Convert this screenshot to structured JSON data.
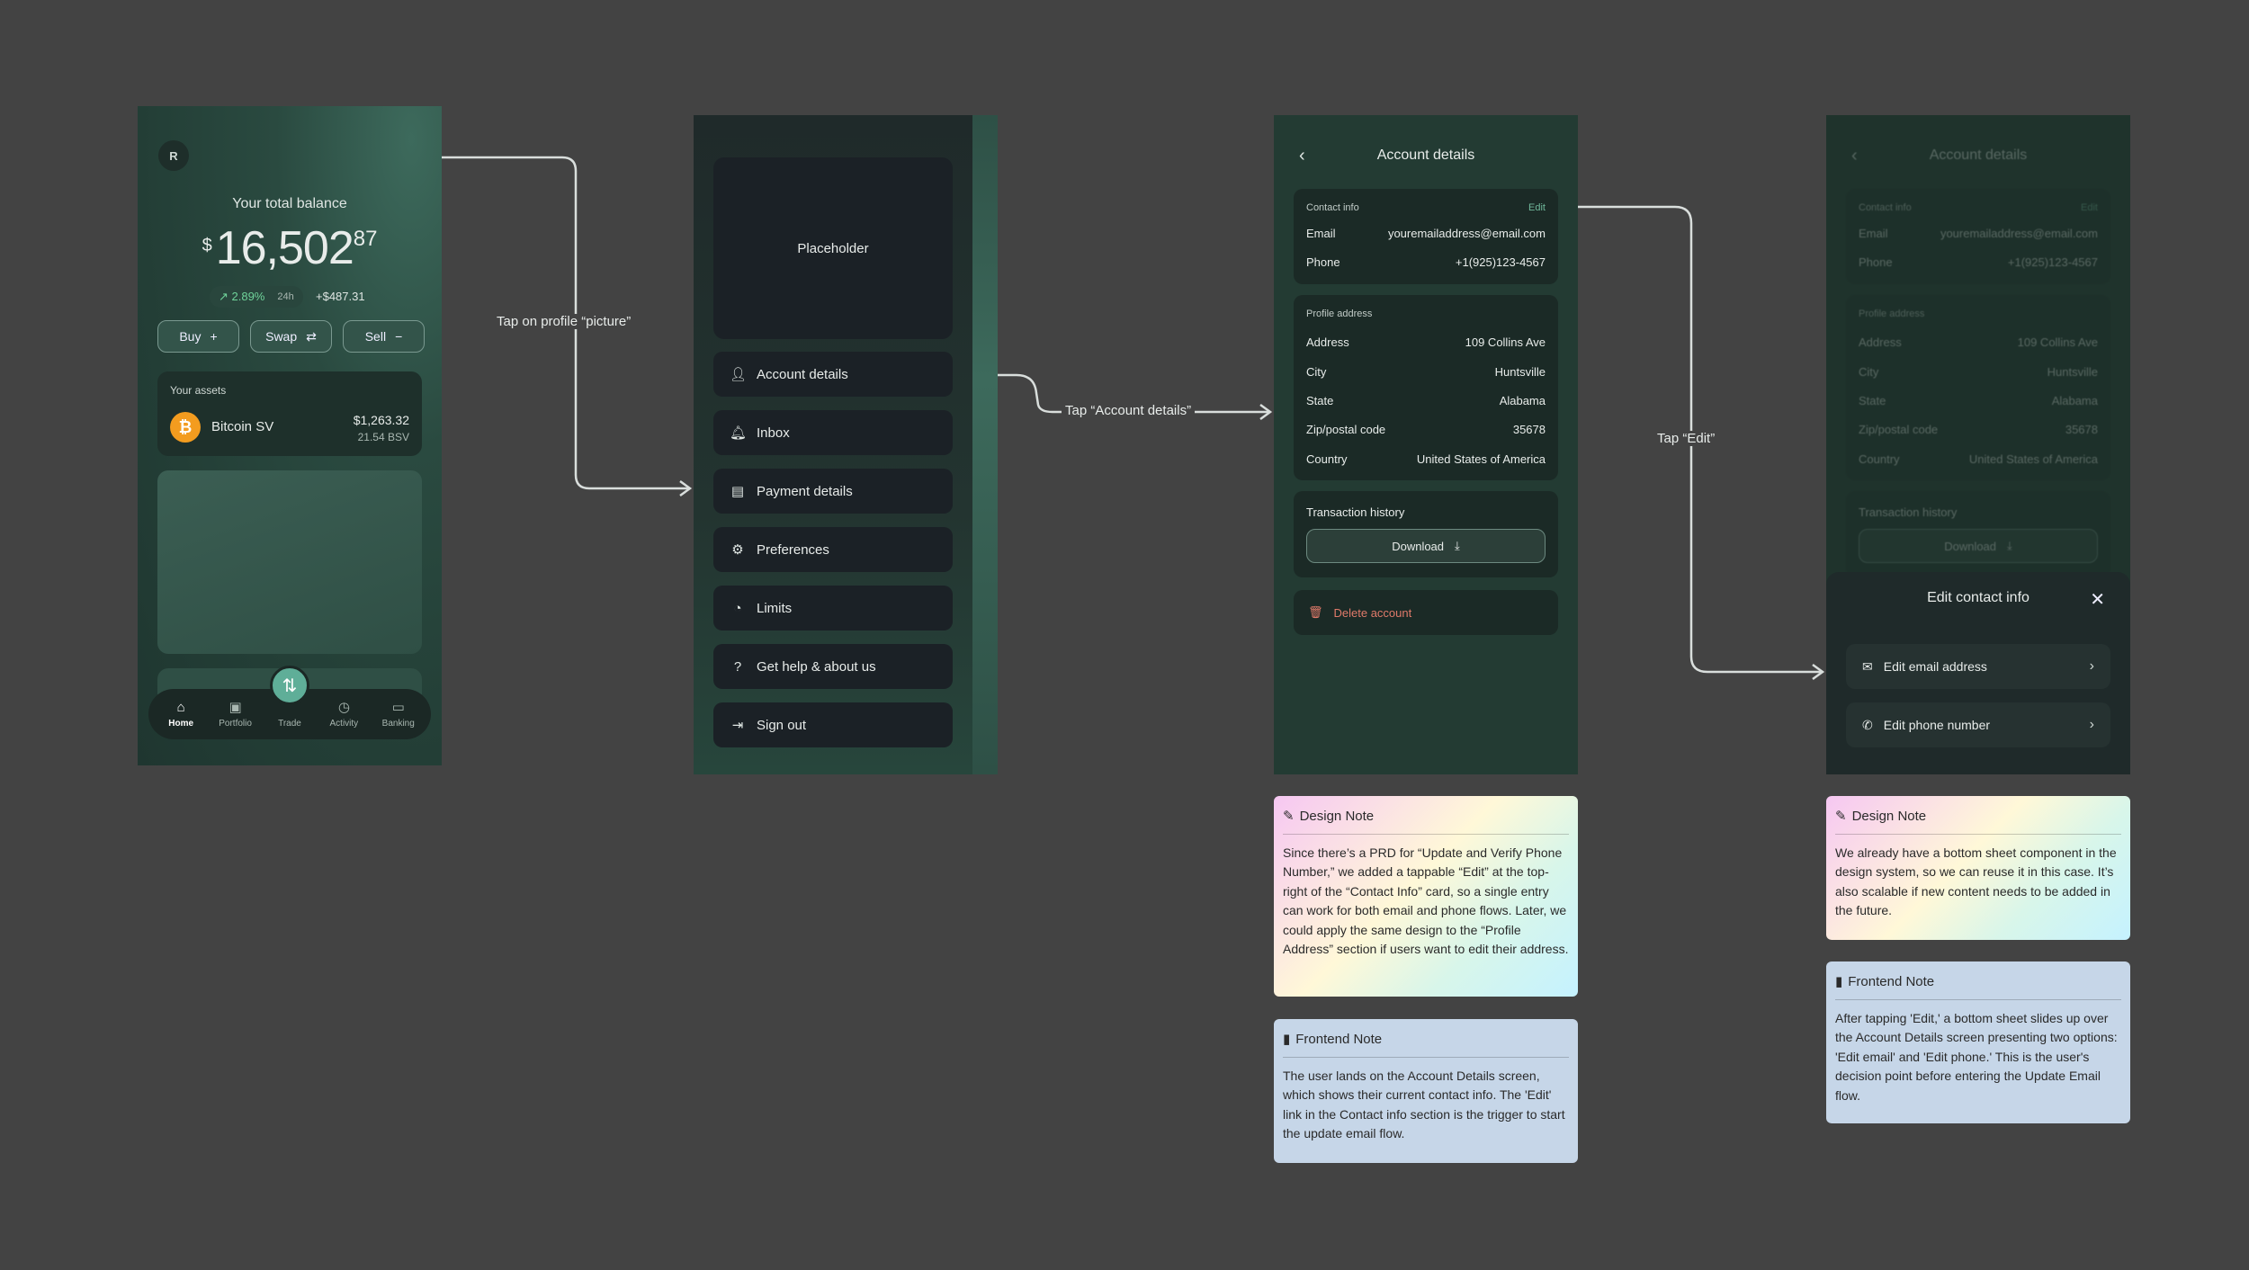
{
  "flow_labels": {
    "profile": "Tap on profile “picture”",
    "account": "Tap “Account details”",
    "edit": "Tap “Edit”"
  },
  "home": {
    "avatar_letter": "R",
    "balance_label": "Your total balance",
    "currency": "$",
    "balance_int": "16,502",
    "balance_dec": "87",
    "change_pct": "↗ 2.89%",
    "change_period": "24h",
    "change_abs": "+$487.31",
    "buy": "Buy",
    "swap": "Swap",
    "sell": "Sell",
    "assets_title": "Your assets",
    "asset_name": "Bitcoin SV",
    "asset_value": "$1,263.32",
    "asset_amount": "21.54 BSV",
    "tabs": [
      "Home",
      "Portfolio",
      "Trade",
      "Activity",
      "Banking"
    ]
  },
  "menu": {
    "placeholder": "Placeholder",
    "items": [
      "Account details",
      "Inbox",
      "Payment details",
      "Preferences",
      "Limits",
      "Get help & about us",
      "Sign out"
    ]
  },
  "account": {
    "title": "Account details",
    "contact_title": "Contact info",
    "edit": "Edit",
    "email_label": "Email",
    "email_value": "youremailaddress@email.com",
    "phone_label": "Phone",
    "phone_value": "+1(925)123-4567",
    "address_title": "Profile address",
    "address_label": "Address",
    "address_value": "109 Collins Ave",
    "city_label": "City",
    "city_value": "Huntsville",
    "state_label": "State",
    "state_value": "Alabama",
    "zip_label": "Zip/postal code",
    "zip_value": "35678",
    "country_label": "Country",
    "country_value": "United States of America",
    "history_title": "Transaction history",
    "download": "Download",
    "delete": "Delete account"
  },
  "sheet": {
    "title": "Edit contact info",
    "edit_email": "Edit email address",
    "edit_phone": "Edit phone number"
  },
  "notes": {
    "design1_title": "Design Note",
    "design1_body": "Since there’s a PRD for “Update and Verify Phone Number,” we added a tappable “Edit” at the top-right of the “Contact Info” card, so a single entry can work for both email and phone flows. Later, we could apply the same design to the “Profile Address” section if users want to edit their address.",
    "front1_title": "Frontend Note",
    "front1_body": "The user lands on the Account Details screen, which shows their current contact info. The 'Edit' link in the Contact info section is the trigger to start the update email flow.",
    "design2_title": "Design Note",
    "design2_body": "We already have a bottom sheet component in the design system, so we can reuse it in this case. It’s also scalable if new content needs to be added in the future.",
    "front2_title": "Frontend Note",
    "front2_body": "After tapping 'Edit,' a bottom sheet slides up over the Account Details screen presenting two options: 'Edit email' and 'Edit phone.' This is the user's decision point before entering the Update Email flow."
  },
  "colors": {
    "canvas": "#434343",
    "accent_green": "#6fd39a",
    "delete_red": "#e07a6a",
    "bitcoin_orange": "#f39c1f"
  }
}
